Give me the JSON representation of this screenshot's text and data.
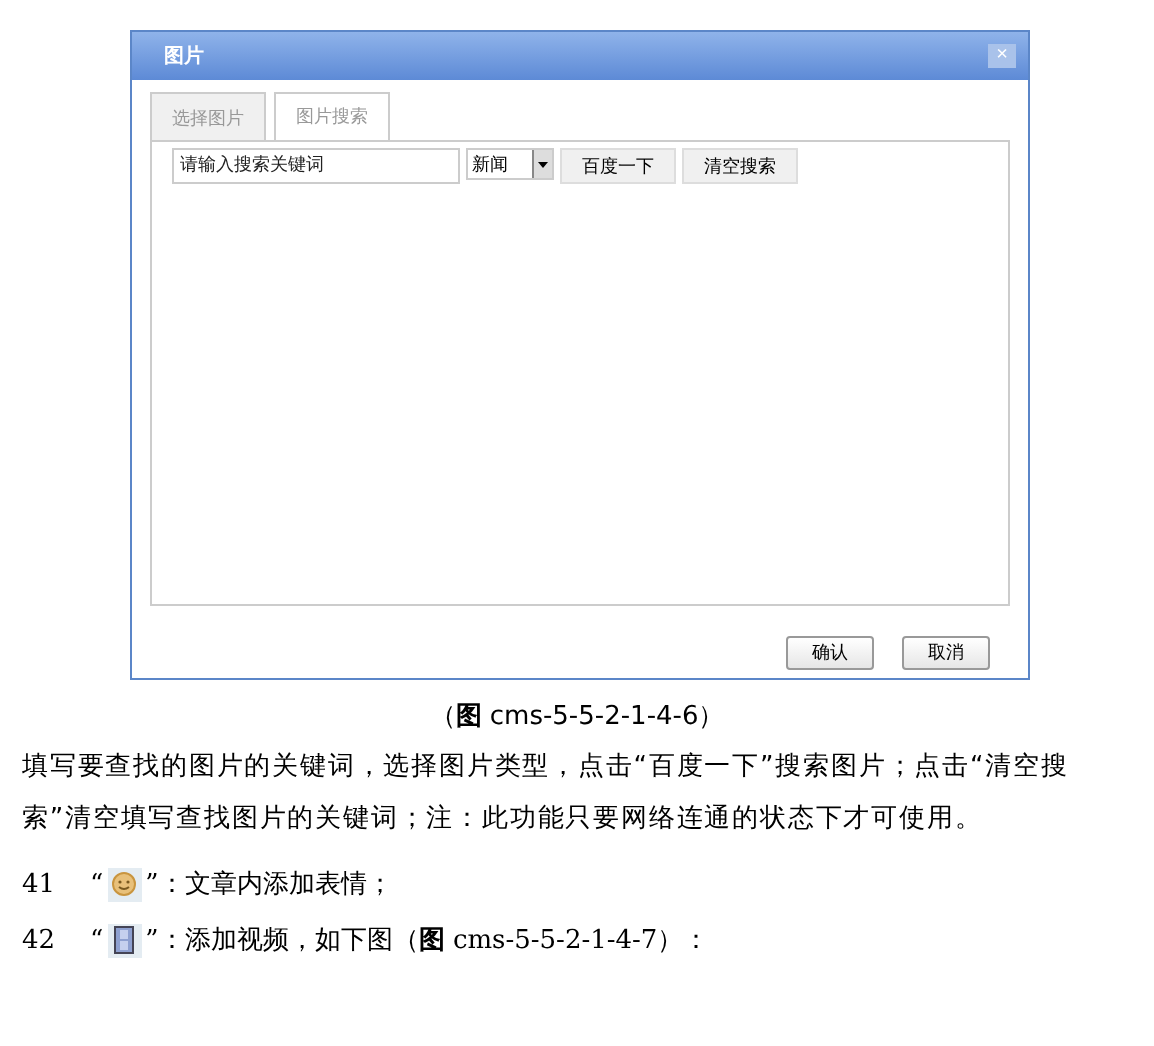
{
  "dialog": {
    "title": "图片",
    "close": "×",
    "tabs": [
      {
        "label": "选择图片",
        "selected": false
      },
      {
        "label": "图片搜索",
        "selected": true
      }
    ],
    "search": {
      "placeholder": "请输入搜索关键词",
      "category": "新闻",
      "buttons": [
        "百度一下",
        "清空搜索"
      ]
    },
    "footer_buttons": [
      "确认",
      "取消"
    ]
  },
  "caption": "（**图** cms-5-5-2-1-4-6）",
  "paragraph": "填写要查找的图片的关键词，选择图片类型，点击“百度一下”搜索图片；点击“清空搜索”清空填写查找图片的关键词；注：此功能只要网络连通的状态下才可使用。",
  "items": [
    {
      "number": "41",
      "open_quote": "“",
      "kind": "smiley",
      "text": "”：文章内添加表情；"
    },
    {
      "number": "42",
      "open_quote": "“",
      "kind": "film",
      "text": "”：添加视频，如下图（**图** cms-5-5-2-1-4-7）："
    }
  ]
}
